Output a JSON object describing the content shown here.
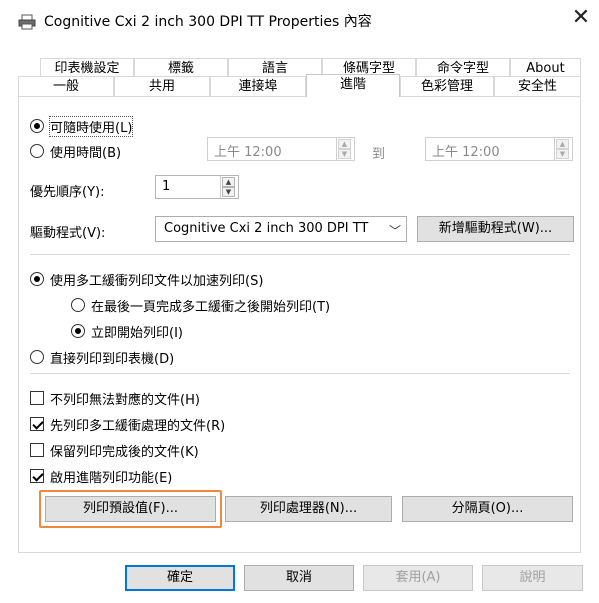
{
  "window": {
    "title": "Cognitive Cxi 2 inch 300 DPI TT Properties 內容",
    "close_symbol": "✕"
  },
  "tabs_row1": [
    "印表機設定",
    "標籤",
    "語言",
    "條碼字型",
    "命令字型",
    "About"
  ],
  "tabs_row2": [
    "一般",
    "共用",
    "連接埠",
    "進階",
    "色彩管理",
    "安全性"
  ],
  "active_tab": "進階",
  "availability": {
    "always_label": "可隨時使用(L)",
    "from_label": "使用時間(B)",
    "from_time": "上午 12:00",
    "to_label": "到",
    "to_time": "上午 12:00",
    "always_checked": true
  },
  "priority": {
    "label": "優先順序(Y):",
    "value": "1"
  },
  "driver": {
    "label": "驅動程式(V):",
    "value": "Cognitive Cxi 2 inch 300 DPI TT",
    "new_driver_button": "新增驅動程式(W)..."
  },
  "spool": {
    "spool_label": "使用多工緩衝列印文件以加速列印(S)",
    "start_after_last_label": "在最後一頁完成多工緩衝之後開始列印(T)",
    "start_immediately_label": "立即開始列印(I)",
    "direct_label": "直接列印到印表機(D)"
  },
  "options": {
    "hold_mismatched": {
      "label": "不列印無法對應的文件(H)",
      "checked": false
    },
    "print_spooled_first": {
      "label": "先列印多工緩衝處理的文件(R)",
      "checked": true
    },
    "keep_printed": {
      "label": "保留列印完成後的文件(K)",
      "checked": false
    },
    "enable_advanced": {
      "label": "啟用進階列印功能(E)",
      "checked": true
    }
  },
  "bottom_buttons": {
    "defaults": "列印預設值(F)...",
    "processor": "列印處理器(N)...",
    "separator": "分隔頁(O)..."
  },
  "dialog_buttons": {
    "ok": "確定",
    "cancel": "取消",
    "apply": "套用(A)",
    "help": "說明"
  },
  "colors": {
    "accent": "#0078d7",
    "highlight_outline": "#f0883e"
  }
}
